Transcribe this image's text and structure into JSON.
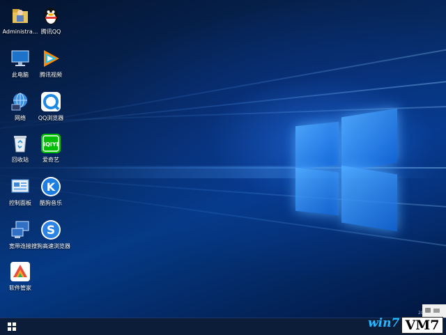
{
  "desktop_icons": [
    {
      "id": "admin",
      "label": "Administra..."
    },
    {
      "id": "qq",
      "label": "腾讯QQ"
    },
    {
      "id": "computer",
      "label": "此电脑"
    },
    {
      "id": "tencent-video",
      "label": "腾讯视频"
    },
    {
      "id": "network",
      "label": "网络"
    },
    {
      "id": "qq-browser",
      "label": "QQ浏览器"
    },
    {
      "id": "recycle-bin",
      "label": "回收站"
    },
    {
      "id": "iqiyi",
      "label": "爱奇艺"
    },
    {
      "id": "control-panel",
      "label": "控制面板"
    },
    {
      "id": "kugou",
      "label": "酷狗音乐"
    },
    {
      "id": "broadband",
      "label": "宽带连接"
    },
    {
      "id": "sogou-browser",
      "label": "搜狗高速浏览器"
    },
    {
      "id": "software-manager",
      "label": "软件管家"
    }
  ],
  "icon_symbols": {
    "iqiyi": "iQIYI",
    "kugou": "K",
    "sogou": "S"
  },
  "taskbar": {
    "start_icon": "windows-logo-icon"
  },
  "watermark": {
    "text": "win7",
    "badge": "VM7"
  },
  "tray": {
    "date_fragment": "2019/8/2"
  },
  "colors": {
    "accent": "#1e90ff",
    "taskbar": "#0c1d3a"
  }
}
